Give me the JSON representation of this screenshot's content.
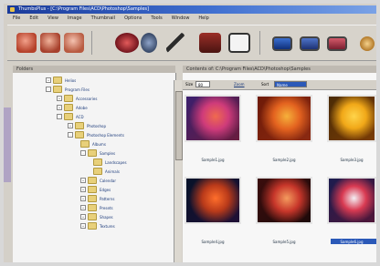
{
  "window": {
    "title": "ThumbsPlus - [C:\\Program Files\\ACD\\Photoshop\\Samples]"
  },
  "menu": [
    "File",
    "Edit",
    "View",
    "Image",
    "Thumbnail",
    "Options",
    "Tools",
    "Window",
    "Help"
  ],
  "panes": {
    "left_title": "Folders",
    "right_title": "Contents of: C:\\Program Files\\ACD\\Photoshop\\Samples"
  },
  "contents_toolbar": {
    "size_label": "Size",
    "size_value": "80",
    "zoom_label": "Zoom",
    "sort_label": "Sort",
    "sort_value": "Name"
  },
  "tree": [
    {
      "label": "Helios",
      "level": 0
    },
    {
      "label": "Program Files",
      "level": 0
    },
    {
      "label": "Accessories",
      "level": 1
    },
    {
      "label": "Adobe",
      "level": 1
    },
    {
      "label": "ACD",
      "level": 1
    },
    {
      "label": "Photoshop",
      "level": 2
    },
    {
      "label": "Photoshop Elements",
      "level": 2
    },
    {
      "label": "Albums",
      "level": 3
    },
    {
      "label": "Samples",
      "level": 3
    },
    {
      "label": "Landscapes",
      "level": 4
    },
    {
      "label": "Animals",
      "level": 4
    },
    {
      "label": "Calendar",
      "level": 2
    },
    {
      "label": "Edges",
      "level": 2
    },
    {
      "label": "Patterns",
      "level": 2
    },
    {
      "label": "Presets",
      "level": 2
    },
    {
      "label": "Shapes",
      "level": 2
    },
    {
      "label": "Textures",
      "level": 2
    }
  ],
  "thumbnails": [
    {
      "caption": "Sample1.jpg",
      "colors": [
        "#3a1f6e",
        "#cf3b7a",
        "#f06a4e",
        "#6a1d3e"
      ]
    },
    {
      "caption": "Sample2.jpg",
      "colors": [
        "#6e1a08",
        "#e3621f",
        "#f6b13b",
        "#8b2a12"
      ]
    },
    {
      "caption": "Sample3.jpg",
      "colors": [
        "#4a2b06",
        "#f1a818",
        "#ffd44a",
        "#7a3c06"
      ]
    },
    {
      "caption": "Sample4.jpg",
      "colors": [
        "#061229",
        "#b93a1a",
        "#ff6f2c",
        "#201036"
      ]
    },
    {
      "caption": "Sample5.jpg",
      "colors": [
        "#3b0d0d",
        "#c7362a",
        "#f49b5e",
        "#1d0a0a"
      ]
    },
    {
      "caption": "Sample6.jpg",
      "colors": [
        "#1c1c4f",
        "#d93a52",
        "#f4f0f4",
        "#4f1638"
      ]
    }
  ],
  "toolbar_icons": [
    "bag-icon",
    "stamp-icon",
    "hand-icon",
    "eye-icon",
    "gears-icon",
    "brush-icon",
    "camera-icon",
    "frame-icon",
    "monitor-icon",
    "picture-icon",
    "slideshow-icon",
    "help-icon"
  ]
}
